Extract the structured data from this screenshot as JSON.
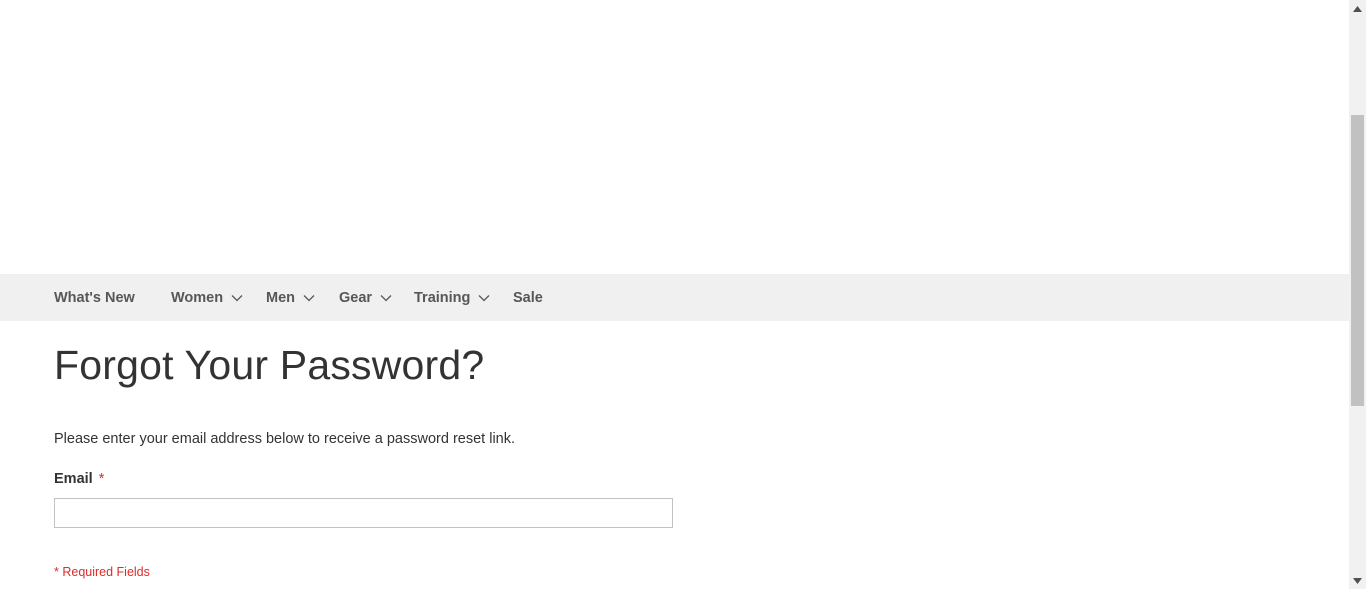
{
  "nav": {
    "items": [
      {
        "label": "What's New",
        "has_dropdown": false
      },
      {
        "label": "Women",
        "has_dropdown": true
      },
      {
        "label": "Men",
        "has_dropdown": true
      },
      {
        "label": "Gear",
        "has_dropdown": true
      },
      {
        "label": "Training",
        "has_dropdown": true
      },
      {
        "label": "Sale",
        "has_dropdown": false
      }
    ]
  },
  "page": {
    "title": "Forgot Your Password?",
    "intro": "Please enter your email address below to receive a password reset link.",
    "email_label": "Email",
    "required_marker": "*",
    "email_value": "",
    "required_note": "* Required Fields"
  },
  "icons": {
    "dropdown": "chevron-down-icon",
    "scroll_up": "arrow-up-icon",
    "scroll_down": "arrow-down-icon"
  },
  "colors": {
    "nav_background": "#f0f0f0",
    "nav_text": "#575757",
    "required": "#e02b27",
    "input_border": "#c2c2c2"
  }
}
